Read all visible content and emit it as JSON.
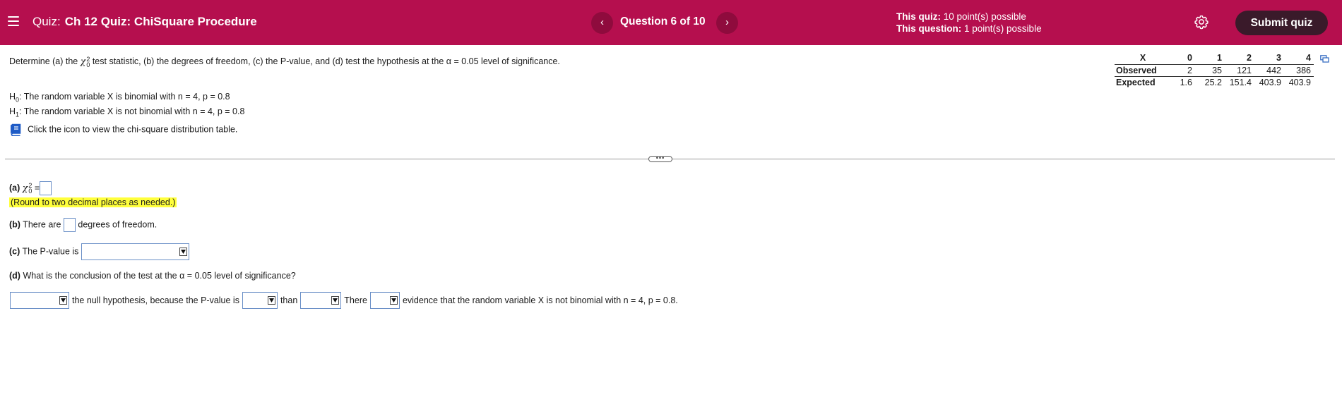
{
  "header": {
    "quiz_label": "Quiz:",
    "quiz_name": "Ch 12 Quiz: ChiSquare Procedure",
    "question_counter": "Question 6 of 10",
    "prev_symbol": "‹",
    "next_symbol": "›",
    "quiz_points_label": "This quiz:",
    "quiz_points_value": "10 point(s) possible",
    "question_points_label": "This question:",
    "question_points_value": "1 point(s) possible",
    "submit_label": "Submit quiz",
    "settings_icon": "gear-icon",
    "menu_icon": "hamburger-icon"
  },
  "question": {
    "prompt_before": "Determine (a) the",
    "chi_symbol": "χ",
    "chi_sup": "2",
    "chi_sub": "0",
    "prompt_after": "test statistic, (b) the degrees of freedom, (c) the P-value, and (d) test the hypothesis at the α = 0.05 level of significance.",
    "h0_letter": "H",
    "h0_sub": "0",
    "h0_text": ": The random variable X is binomial with n = 4, p = 0.8",
    "h1_letter": "H",
    "h1_sub": "1",
    "h1_text": ": The random variable X is not binomial with n = 4, p = 0.8",
    "table_link_text": "Click the icon to view the chi-square distribution table.",
    "book_icon": "book-icon"
  },
  "data_table": {
    "x_header": "X",
    "x_values": [
      "0",
      "1",
      "2",
      "3",
      "4"
    ],
    "observed_label": "Observed",
    "observed": [
      "2",
      "35",
      "121",
      "442",
      "386"
    ],
    "expected_label": "Expected",
    "expected": [
      "1.6",
      "25.2",
      "151.4",
      "403.9",
      "403.9"
    ]
  },
  "divider": {
    "handle_text": "•••"
  },
  "answers": {
    "a_label": "(a)",
    "a_chi": "χ",
    "a_sup": "2",
    "a_sub": "0",
    "a_equals": "=",
    "a_hint": "(Round to two decimal places as needed.)",
    "b_label": "(b)",
    "b_before": "There are",
    "b_after": "degrees of freedom.",
    "c_label": "(c)",
    "c_text": "The P-value is",
    "d_label": "(d)",
    "d_text": "What is the conclusion of the test at the α = 0.05 level of significance?",
    "d_part1": "the null hypothesis, because the P-value is",
    "d_part2": "than",
    "d_part3": "There",
    "d_part4": "evidence that the random variable X is not binomial with n = 4, p = 0.8."
  },
  "colors": {
    "header_bg": "#b50f4e",
    "submit_bg": "#3a1a2a",
    "hint_highlight": "#ffff3b",
    "input_border": "#6a8fc7"
  }
}
